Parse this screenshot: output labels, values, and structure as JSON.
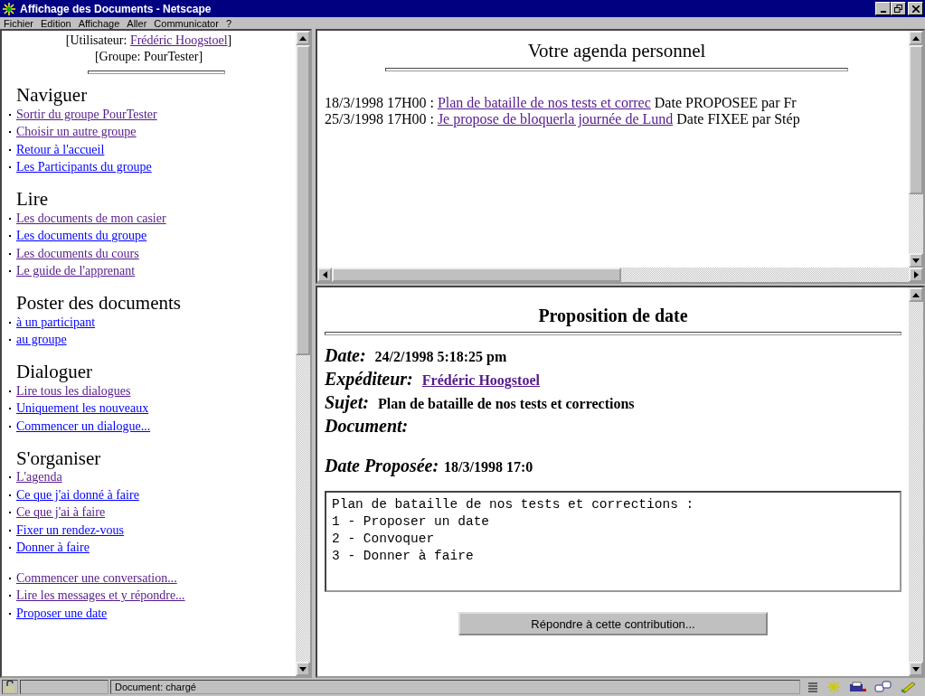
{
  "window": {
    "title": "Affichage des Documents - Netscape"
  },
  "menu": [
    "Fichier",
    "Edition",
    "Affichage",
    "Aller",
    "Communicator",
    "?"
  ],
  "sidebar": {
    "user_label": "[Utilisateur: ",
    "user_name": "Frédéric Hoogstoel",
    "user_end": "]",
    "group": "[Groupe: PourTester]",
    "sections": [
      {
        "title": "Naviguer",
        "links": [
          {
            "label": "Sortir du groupe PourTester",
            "visited": true
          },
          {
            "label": "Choisir un autre groupe",
            "visited": true
          },
          {
            "label": "Retour à l'accueil",
            "visited": false
          },
          {
            "label": "Les Participants du groupe ",
            "visited": false
          }
        ]
      },
      {
        "title": "Lire",
        "links": [
          {
            "label": "Les documents de mon casier",
            "visited": true
          },
          {
            "label": "Les documents du groupe",
            "visited": false
          },
          {
            "label": "Les documents du cours",
            "visited": true
          },
          {
            "label": "Le guide de l'apprenant",
            "visited": true
          }
        ]
      },
      {
        "title": "Poster des documents",
        "links": [
          {
            "label": "à un participant",
            "visited": false
          },
          {
            "label": "au groupe",
            "visited": false
          }
        ]
      },
      {
        "title": "Dialoguer",
        "links": [
          {
            "label": "Lire tous les dialogues",
            "visited": true
          },
          {
            "label": "Uniquement les nouveaux",
            "visited": false
          },
          {
            "label": "Commencer un dialogue...",
            "visited": false
          }
        ]
      },
      {
        "title": "S'organiser",
        "links": [
          {
            "label": "L'agenda ",
            "visited": true
          },
          {
            "label": "Ce que j'ai donné à faire",
            "visited": false
          },
          {
            "label": "Ce que j'ai à faire",
            "visited": true
          },
          {
            "label": "Fixer un rendez-vous",
            "visited": false
          },
          {
            "label": "Donner à faire",
            "visited": false
          }
        ]
      },
      {
        "links": [
          {
            "label": "Commencer une conversation...",
            "visited": true
          },
          {
            "label": "Lire les messages et y répondre...",
            "visited": true
          },
          {
            "label": "Proposer une date",
            "visited": false
          }
        ]
      }
    ]
  },
  "agenda": {
    "title": "Votre agenda personnel",
    "entries": [
      {
        "date": "18/3/1998 17H00 :",
        "link": "Plan de bataille de nos tests et correc",
        "visited": true,
        "status": "Date PROPOSEE par Fr"
      },
      {
        "date": "25/3/1998 17H00 :",
        "link": "Je propose de bloquerla journée de Lund",
        "visited": true,
        "status": "Date FIXEE par Stép"
      }
    ]
  },
  "proposal": {
    "title": "Proposition de date",
    "fields": [
      {
        "label": "Date:",
        "value": "24/2/1998 5:18:25 pm",
        "kind": "text"
      },
      {
        "label": "Expéditeur:",
        "value": "Frédéric Hoogstoel",
        "kind": "link"
      },
      {
        "label": "Sujet:",
        "value": "Plan de bataille de nos tests et corrections",
        "kind": "text"
      },
      {
        "label": "Document:"
      }
    ],
    "proposed_label": "Date Proposée:",
    "proposed_value": "18/3/1998 17:0",
    "message": "Plan de bataille de nos tests et corrections :\n1 - Proposer un date\n2 - Convoquer\n3 - Donner à faire",
    "reply_button": "Répondre à cette contribution..."
  },
  "status_bar": {
    "text": "Document: chargé"
  }
}
